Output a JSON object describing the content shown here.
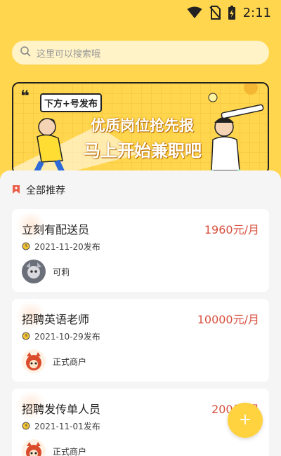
{
  "status": {
    "time": "2:11"
  },
  "search": {
    "placeholder": "这里可以搜索哦"
  },
  "banner": {
    "tag": "下方+号发布",
    "line1": "优质岗位抢先报",
    "line2": "马上开始兼职吧",
    "quote": "❝"
  },
  "section": {
    "title": "全部推荐"
  },
  "jobs": [
    {
      "title": "立刻有配送员",
      "salary": "1960元/月",
      "date": "2021-11-20发布",
      "poster": "可莉"
    },
    {
      "title": "招聘英语老师",
      "salary": "10000元/月",
      "date": "2021-10-29发布",
      "poster": "正式商户"
    },
    {
      "title": "招聘发传单人员",
      "salary": "200元/月",
      "date": "2021-11-01发布",
      "poster": "正式商户"
    }
  ],
  "fab": {
    "label": "+"
  },
  "colors": {
    "accent": "#ffd64d",
    "salary": "#d8513f"
  }
}
